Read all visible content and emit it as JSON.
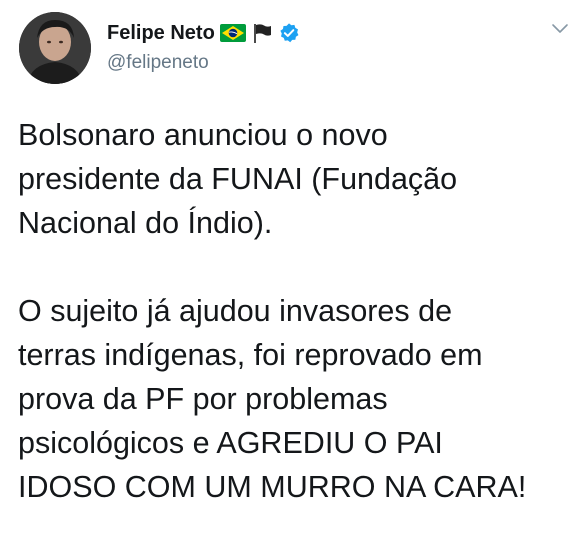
{
  "tweet": {
    "author": {
      "display_name": "Felipe Neto",
      "handle": "@felipeneto",
      "name_icons": [
        "brazil-flag-icon",
        "black-flag-icon",
        "verified-badge-icon"
      ]
    },
    "text": {
      "paragraph1_lines": [
        "Bolsonaro anunciou o novo",
        "presidente da FUNAI (Fundação",
        "Nacional do Índio)."
      ],
      "paragraph2_lines": [
        "O sujeito já ajudou invasores de",
        "terras indígenas, foi reprovado em",
        "prova da PF por problemas",
        "psicológicos e AGREDIU O PAI",
        "IDOSO COM UM MURRO NA CARA!"
      ]
    },
    "menu_icon": "chevron-down-icon"
  },
  "colors": {
    "text_primary": "#14171a",
    "text_secondary": "#657786",
    "verified_blue": "#1da1f2",
    "brazil_green": "#009c3b",
    "brazil_yellow": "#ffdf00",
    "brazil_blue": "#002776"
  }
}
